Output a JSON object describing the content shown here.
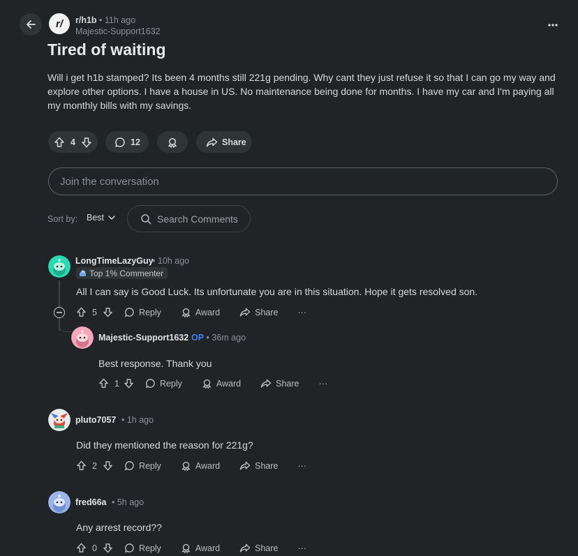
{
  "post": {
    "subreddit": "r/h1b",
    "subreddit_icon_text": "r/",
    "time_ago": "• 11h ago",
    "author": "Majestic-Support1632",
    "title": "Tired of waiting",
    "body": "Will i get h1b stamped? Its been 4 months still 221g pending. Why cant they just refuse it so that I can go my way and explore other options. I have a house in US. No maintenance being done for months. I have my car and I'm paying all my monthly bills with my savings.",
    "votes": "4",
    "comments": "12",
    "share_label": "Share"
  },
  "join": {
    "placeholder": "Join the conversation"
  },
  "sort": {
    "label": "Sort by:",
    "value": "Best"
  },
  "search": {
    "placeholder": "Search Comments"
  },
  "labels": {
    "reply": "Reply",
    "award": "Award",
    "share": "Share",
    "more": "···"
  },
  "comments": [
    {
      "username": "LongTimeLazyGuy",
      "time": "• 10h ago",
      "badge": "Top 1% Commenter",
      "text": "All I can say is Good Luck. Its unfortunate you are in this situation. Hope it gets resolved son.",
      "votes": "5"
    },
    {
      "username": "Majestic-Support1632",
      "op": "OP",
      "time": "• 36m ago",
      "text": "Best response. Thank you",
      "votes": "1"
    },
    {
      "username": "pluto7057",
      "time": "• 1h ago",
      "text": "Did they mentioned the reason for 221g?",
      "votes": "2"
    },
    {
      "username": "fred66a",
      "time": "• 5h ago",
      "text": "Any arrest record??",
      "votes": "0"
    }
  ],
  "colors": {
    "background": "#202426",
    "pill": "#2f3437",
    "op_accent": "#3b82f6"
  }
}
